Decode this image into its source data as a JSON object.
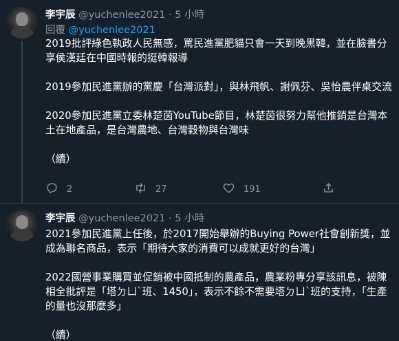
{
  "tweets": [
    {
      "name": "李宇辰",
      "handle": "@yuchenlee2021",
      "dot": "·",
      "time": "5 小時",
      "reply_prefix": "回覆",
      "reply_handle": "@yuchenlee2021",
      "paragraphs": [
        "2019批評綠色執政人民無感，罵民進黨肥貓只會一天到晚黑韓，並在臉書分享侯漢廷在中國時報的挺韓報導",
        "2019參加民進黨辦的黨慶「台灣派對」，與林飛帆、謝佩芬、吳怡農伴桌交流",
        "2020參加民進黨立委林楚茵YouTube節目，林楚茵很努力幫他推銷是台灣本土在地產品，是台灣農地、台灣穀物與台灣味",
        "（續）"
      ],
      "replies": "2",
      "retweets": "27",
      "likes": "191"
    },
    {
      "name": "李宇辰",
      "handle": "@yuchenlee2021",
      "dot": "·",
      "time": "5 小時",
      "paragraphs": [
        "2021參加民進黨上任後，於2017開始舉辦的Buying Power社會創新獎，並成為聯名商品，表示「期待大家的消費可以成就更好的台灣」",
        "2022國營事業購買並促銷被中國抵制的農產品，農業粉專分享該訊息，被陳相全批評是「塔ㄉㄩˋ班、1450」，表示不餘不需要塔ㄉㄩˋ班的支持，「生產的量也沒那麼多」",
        "（續）"
      ]
    }
  ]
}
